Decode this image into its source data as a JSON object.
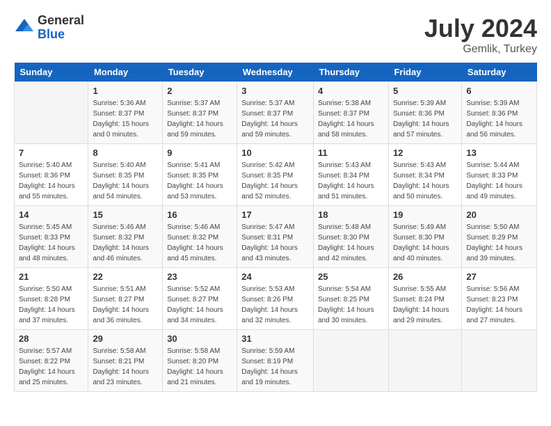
{
  "logo": {
    "general": "General",
    "blue": "Blue"
  },
  "title": "July 2024",
  "subtitle": "Gemlik, Turkey",
  "days_header": [
    "Sunday",
    "Monday",
    "Tuesday",
    "Wednesday",
    "Thursday",
    "Friday",
    "Saturday"
  ],
  "weeks": [
    [
      {
        "day": "",
        "info": ""
      },
      {
        "day": "1",
        "info": "Sunrise: 5:36 AM\nSunset: 8:37 PM\nDaylight: 15 hours\nand 0 minutes."
      },
      {
        "day": "2",
        "info": "Sunrise: 5:37 AM\nSunset: 8:37 PM\nDaylight: 14 hours\nand 59 minutes."
      },
      {
        "day": "3",
        "info": "Sunrise: 5:37 AM\nSunset: 8:37 PM\nDaylight: 14 hours\nand 59 minutes."
      },
      {
        "day": "4",
        "info": "Sunrise: 5:38 AM\nSunset: 8:37 PM\nDaylight: 14 hours\nand 58 minutes."
      },
      {
        "day": "5",
        "info": "Sunrise: 5:39 AM\nSunset: 8:36 PM\nDaylight: 14 hours\nand 57 minutes."
      },
      {
        "day": "6",
        "info": "Sunrise: 5:39 AM\nSunset: 8:36 PM\nDaylight: 14 hours\nand 56 minutes."
      }
    ],
    [
      {
        "day": "7",
        "info": "Sunrise: 5:40 AM\nSunset: 8:36 PM\nDaylight: 14 hours\nand 55 minutes."
      },
      {
        "day": "8",
        "info": "Sunrise: 5:40 AM\nSunset: 8:35 PM\nDaylight: 14 hours\nand 54 minutes."
      },
      {
        "day": "9",
        "info": "Sunrise: 5:41 AM\nSunset: 8:35 PM\nDaylight: 14 hours\nand 53 minutes."
      },
      {
        "day": "10",
        "info": "Sunrise: 5:42 AM\nSunset: 8:35 PM\nDaylight: 14 hours\nand 52 minutes."
      },
      {
        "day": "11",
        "info": "Sunrise: 5:43 AM\nSunset: 8:34 PM\nDaylight: 14 hours\nand 51 minutes."
      },
      {
        "day": "12",
        "info": "Sunrise: 5:43 AM\nSunset: 8:34 PM\nDaylight: 14 hours\nand 50 minutes."
      },
      {
        "day": "13",
        "info": "Sunrise: 5:44 AM\nSunset: 8:33 PM\nDaylight: 14 hours\nand 49 minutes."
      }
    ],
    [
      {
        "day": "14",
        "info": "Sunrise: 5:45 AM\nSunset: 8:33 PM\nDaylight: 14 hours\nand 48 minutes."
      },
      {
        "day": "15",
        "info": "Sunrise: 5:46 AM\nSunset: 8:32 PM\nDaylight: 14 hours\nand 46 minutes."
      },
      {
        "day": "16",
        "info": "Sunrise: 5:46 AM\nSunset: 8:32 PM\nDaylight: 14 hours\nand 45 minutes."
      },
      {
        "day": "17",
        "info": "Sunrise: 5:47 AM\nSunset: 8:31 PM\nDaylight: 14 hours\nand 43 minutes."
      },
      {
        "day": "18",
        "info": "Sunrise: 5:48 AM\nSunset: 8:30 PM\nDaylight: 14 hours\nand 42 minutes."
      },
      {
        "day": "19",
        "info": "Sunrise: 5:49 AM\nSunset: 8:30 PM\nDaylight: 14 hours\nand 40 minutes."
      },
      {
        "day": "20",
        "info": "Sunrise: 5:50 AM\nSunset: 8:29 PM\nDaylight: 14 hours\nand 39 minutes."
      }
    ],
    [
      {
        "day": "21",
        "info": "Sunrise: 5:50 AM\nSunset: 8:28 PM\nDaylight: 14 hours\nand 37 minutes."
      },
      {
        "day": "22",
        "info": "Sunrise: 5:51 AM\nSunset: 8:27 PM\nDaylight: 14 hours\nand 36 minutes."
      },
      {
        "day": "23",
        "info": "Sunrise: 5:52 AM\nSunset: 8:27 PM\nDaylight: 14 hours\nand 34 minutes."
      },
      {
        "day": "24",
        "info": "Sunrise: 5:53 AM\nSunset: 8:26 PM\nDaylight: 14 hours\nand 32 minutes."
      },
      {
        "day": "25",
        "info": "Sunrise: 5:54 AM\nSunset: 8:25 PM\nDaylight: 14 hours\nand 30 minutes."
      },
      {
        "day": "26",
        "info": "Sunrise: 5:55 AM\nSunset: 8:24 PM\nDaylight: 14 hours\nand 29 minutes."
      },
      {
        "day": "27",
        "info": "Sunrise: 5:56 AM\nSunset: 8:23 PM\nDaylight: 14 hours\nand 27 minutes."
      }
    ],
    [
      {
        "day": "28",
        "info": "Sunrise: 5:57 AM\nSunset: 8:22 PM\nDaylight: 14 hours\nand 25 minutes."
      },
      {
        "day": "29",
        "info": "Sunrise: 5:58 AM\nSunset: 8:21 PM\nDaylight: 14 hours\nand 23 minutes."
      },
      {
        "day": "30",
        "info": "Sunrise: 5:58 AM\nSunset: 8:20 PM\nDaylight: 14 hours\nand 21 minutes."
      },
      {
        "day": "31",
        "info": "Sunrise: 5:59 AM\nSunset: 8:19 PM\nDaylight: 14 hours\nand 19 minutes."
      },
      {
        "day": "",
        "info": ""
      },
      {
        "day": "",
        "info": ""
      },
      {
        "day": "",
        "info": ""
      }
    ]
  ]
}
